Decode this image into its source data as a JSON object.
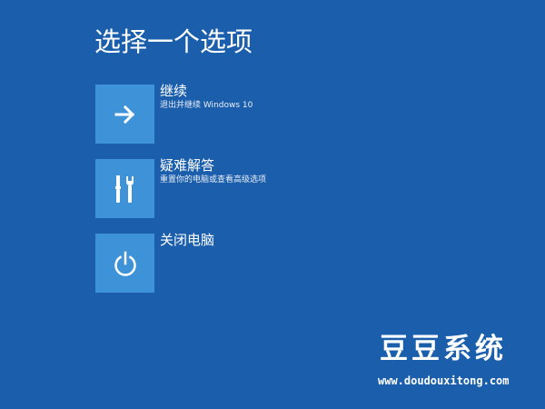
{
  "screen": {
    "title": "选择一个选项",
    "background_color": "#1b5fac",
    "tile_color": "#3e93d8"
  },
  "options": [
    {
      "label": "继续",
      "description": "退出并继续 Windows 10",
      "icon": "arrow-right-icon"
    },
    {
      "label": "疑难解答",
      "description": "重置你的电脑或查看高级选项",
      "icon": "tools-icon"
    },
    {
      "label": "关闭电脑",
      "description": "",
      "icon": "power-icon"
    }
  ],
  "watermark": {
    "brand": "豆豆系统",
    "url": "www.doudouxitong.com"
  }
}
